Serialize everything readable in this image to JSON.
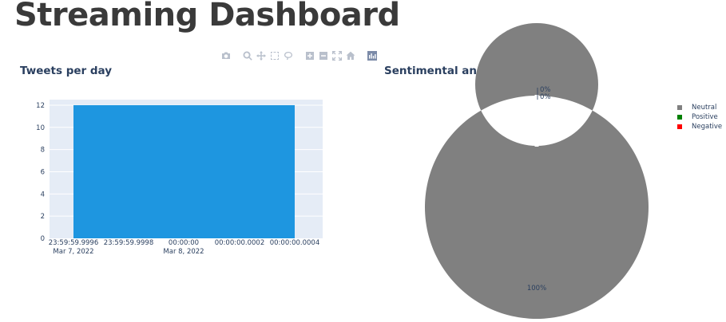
{
  "page": {
    "title": "Streaming Dashboard"
  },
  "modebar": [
    {
      "name": "camera-icon"
    },
    {
      "name": "zoom-icon"
    },
    {
      "name": "pan-icon"
    },
    {
      "name": "box-select-icon"
    },
    {
      "name": "lasso-select-icon"
    },
    {
      "name": "zoom-in-icon"
    },
    {
      "name": "zoom-out-icon"
    },
    {
      "name": "autoscale-icon"
    },
    {
      "name": "reset-axes-icon"
    },
    {
      "name": "plotly-logo-icon"
    }
  ],
  "chart_data": [
    {
      "type": "bar",
      "title": "Tweets per day",
      "x": [
        "2022-03-08"
      ],
      "values": [
        12
      ],
      "color": "#1e96e0",
      "ylim": [
        0,
        12.5
      ],
      "yticks": [
        "0",
        "2",
        "4",
        "6",
        "8",
        "10",
        "12"
      ],
      "xticks": [
        {
          "line1": "23:59:59.9996",
          "line2": "Mar 7, 2022"
        },
        {
          "line1": "23:59:59.9998",
          "line2": ""
        },
        {
          "line1": "00:00:00",
          "line2": "Mar 8, 2022"
        },
        {
          "line1": "00:00:00.0002",
          "line2": ""
        },
        {
          "line1": "00:00:00.0004",
          "line2": ""
        }
      ],
      "plot_background": "#e5ecf6",
      "grid": true
    },
    {
      "type": "pie",
      "title": "Sentimental analysis",
      "hole": 0.55,
      "labels": [
        "Neutral",
        "Positive",
        "Negative"
      ],
      "values": [
        100,
        0,
        0
      ],
      "percent_labels": [
        "100%",
        "0%",
        "0%"
      ],
      "colors": [
        "#808080",
        "#008000",
        "#ff0000"
      ],
      "legend_position": "top-right"
    }
  ]
}
